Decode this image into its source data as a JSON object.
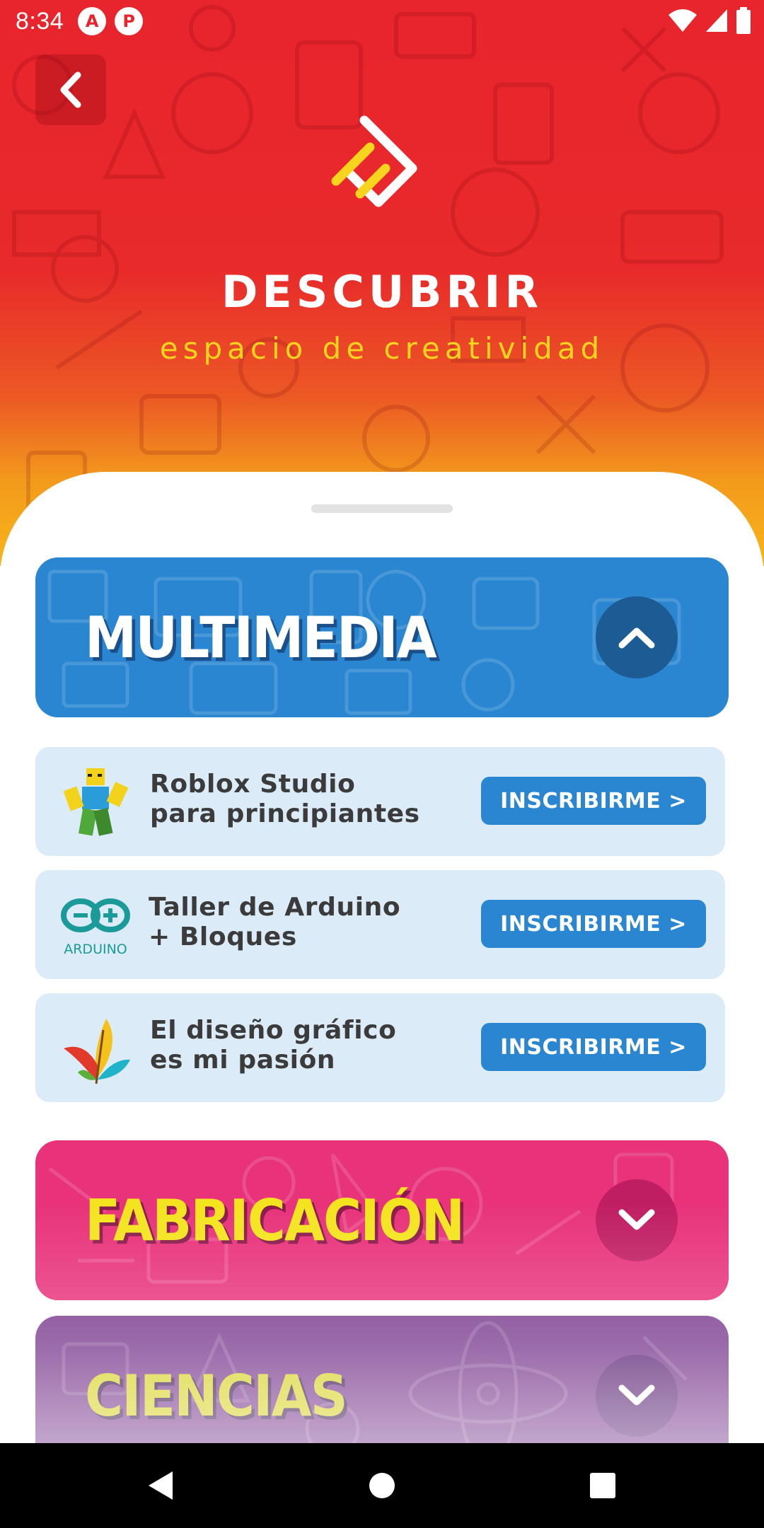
{
  "status_bar": {
    "time": "8:34",
    "app_icons": [
      "app-a-icon",
      "app-p-icon"
    ],
    "app_icon_letters": [
      "A",
      "P"
    ],
    "right_icons": [
      "wifi-icon",
      "cellular-signal-icon",
      "battery-icon"
    ]
  },
  "header": {
    "back_icon": "chevron-left-icon",
    "logo_icon": "descubrir-logo-icon",
    "title": "DESCUBRIR",
    "subtitle": "espacio de creatividad",
    "colors": {
      "top": "#e8242c",
      "bottom": "#f7b51a",
      "subtitle": "#f7d51f"
    }
  },
  "categories": [
    {
      "title": "MULTIMEDIA",
      "expanded": true,
      "toggle_icon": "chevron-up-icon",
      "color": "#2a86d0",
      "title_color": "#ffffff"
    },
    {
      "title": "FABRICACIÓN",
      "expanded": false,
      "toggle_icon": "chevron-down-icon",
      "color": "#e8327a",
      "title_color": "#f4e41e"
    },
    {
      "title": "CIENCIAS",
      "expanded": false,
      "toggle_icon": "chevron-down-icon",
      "color": "#7a3a8e",
      "title_color": "#d9d42a"
    }
  ],
  "courses": [
    {
      "line1": "Roblox Studio",
      "line2": "para principiantes",
      "icon": "roblox-figure-icon",
      "button": "INSCRIBIRME >"
    },
    {
      "line1": "Taller de Arduino",
      "line2": "+ Bloques",
      "icon": "arduino-logo-icon",
      "icon_text": "ARDUINO",
      "button": "INSCRIBIRME >"
    },
    {
      "line1": "El diseño gráfico",
      "line2": "es mi pasión",
      "icon": "feather-icon",
      "button": "INSCRIBIRME >"
    }
  ],
  "nav_bar": {
    "back": "nav-back-icon",
    "home": "nav-home-icon",
    "recents": "nav-recents-icon"
  },
  "accent_colors": {
    "button": "#2a86d0",
    "course_card": "#dcebf8",
    "course_text": "#3b3b3b"
  }
}
